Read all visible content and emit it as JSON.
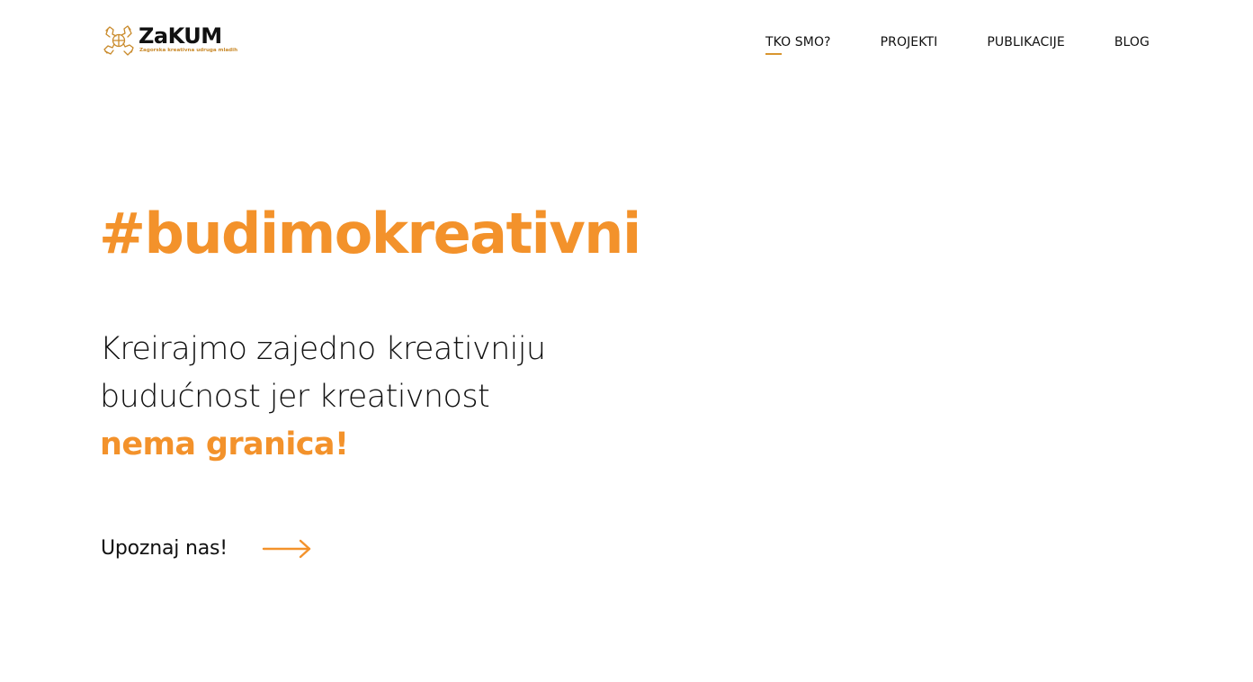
{
  "header": {
    "logo": {
      "name": "ZaKUM",
      "tagline": "Zagorska kreativna udruga mladih",
      "icon": "hands-circle-logo-icon"
    },
    "nav": [
      {
        "label": "TKO SMO?",
        "active": true
      },
      {
        "label": "PROJEKTI",
        "active": false
      },
      {
        "label": "PUBLIKACIJE",
        "active": false
      },
      {
        "label": "BLOG",
        "active": false
      }
    ]
  },
  "hero": {
    "hashtag": "#budimokreativni",
    "lines": [
      "Kreirajmo zajedno kreativniju",
      "budućnost jer kreativnost"
    ],
    "accent": "nema granica!",
    "cta": {
      "label": "Upoznaj nas!",
      "icon": "arrow-right-icon"
    }
  },
  "colors": {
    "accent": "#f3922b",
    "underline": "#d9962f",
    "logo_gold": "#c98a2b",
    "text": "#111111",
    "background": "#ffffff"
  }
}
